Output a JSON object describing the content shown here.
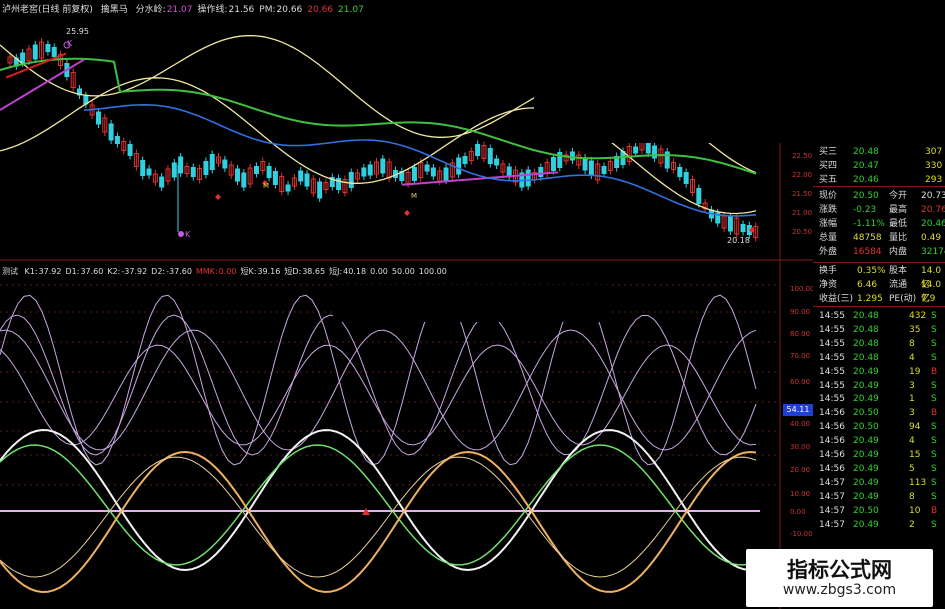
{
  "header": {
    "title": "泸州老窖(日线 前复权)",
    "indicator_name": "擒黑马",
    "fields": [
      {
        "label": "分水岭:",
        "value": "21.07",
        "color": "#d94cd9"
      },
      {
        "label": "操作线:",
        "value": "21.56",
        "color": "#dddddd"
      },
      {
        "label": "PM:",
        "value": "20.66",
        "color": "#dddddd"
      },
      {
        "label": "",
        "value": "20.66",
        "color": "#e03030"
      },
      {
        "label": "",
        "value": "21.07",
        "color": "#30d030"
      }
    ]
  },
  "price_labels": {
    "high": "25.95",
    "low": "20.18",
    "marks": [
      "K",
      "K",
      "M",
      "M"
    ]
  },
  "price_axis": [
    "22.50",
    "22.00",
    "21.50",
    "21.00",
    "20.50"
  ],
  "indicator_header": {
    "name": "测试",
    "fields": [
      {
        "label": "K1:",
        "value": "37.92",
        "color": "#dddddd"
      },
      {
        "label": "D1:",
        "value": "37.60",
        "color": "#dddddd"
      },
      {
        "label": "K2:",
        "value": "-37.92",
        "color": "#dddddd"
      },
      {
        "label": "D2:",
        "value": "-37.60",
        "color": "#dddddd"
      },
      {
        "label": "MMK:",
        "value": "0.00",
        "color": "#e03030"
      },
      {
        "label": "短K:",
        "value": "39.16",
        "color": "#dddddd"
      },
      {
        "label": "短D:",
        "value": "38.65",
        "color": "#dddddd"
      },
      {
        "label": "短J:",
        "value": "40.18",
        "color": "#dddddd"
      },
      {
        "label": "",
        "value": "0.00",
        "color": "#dddddd"
      },
      {
        "label": "",
        "value": "50.00",
        "color": "#dddddd"
      },
      {
        "label": "",
        "value": "100.00",
        "color": "#dddddd"
      }
    ]
  },
  "indicator_axis": [
    "100.00",
    "90.00",
    "80.00",
    "70.00",
    "60.00",
    "40.00",
    "30.00",
    "20.00",
    "10.00",
    "0.00",
    "-10.00",
    "-20.00"
  ],
  "indicator_badge": "54.11",
  "quotes": {
    "asks": [
      {
        "label": "买三",
        "price": "20.48",
        "vol": "307"
      },
      {
        "label": "买四",
        "price": "20.47",
        "vol": "330"
      },
      {
        "label": "买五",
        "price": "20.46",
        "vol": "293"
      }
    ],
    "stats": [
      {
        "l1": "现价",
        "v1": "20.50",
        "l2": "今开",
        "v2": "20.73",
        "c1": "#30d030",
        "c2": "#dddddd"
      },
      {
        "l1": "涨跌",
        "v1": "-0.23",
        "l2": "最高",
        "v2": "20.76",
        "c1": "#30d030",
        "c2": "#e03030"
      },
      {
        "l1": "涨幅",
        "v1": "-1.11%",
        "l2": "最低",
        "v2": "20.46",
        "c1": "#30d030",
        "c2": "#30d030"
      },
      {
        "l1": "总量",
        "v1": "48758",
        "l2": "量比",
        "v2": "0.49",
        "c1": "#dddd30",
        "c2": "#dddd30"
      },
      {
        "l1": "外盘",
        "v1": "16584",
        "l2": "内盘",
        "v2": "32174",
        "c1": "#e03030",
        "c2": "#30d030"
      }
    ],
    "stats2": [
      {
        "l1": "换手",
        "v1": "0.35%",
        "l2": "股本",
        "v2": "14.0亿"
      },
      {
        "l1": "净资",
        "v1": "6.46",
        "l2": "流通",
        "v2": "14.0亿"
      },
      {
        "l1": "收益(三)",
        "v1": "1.295",
        "l2": "PE(动)",
        "v2": "7.9"
      }
    ],
    "ticks": [
      {
        "time": "14:55",
        "price": "20.48",
        "vol": "432",
        "side": "S"
      },
      {
        "time": "14:55",
        "price": "20.48",
        "vol": "35",
        "side": "S"
      },
      {
        "time": "14:55",
        "price": "20.48",
        "vol": "8",
        "side": "S"
      },
      {
        "time": "14:55",
        "price": "20.48",
        "vol": "4",
        "side": "S"
      },
      {
        "time": "14:55",
        "price": "20.49",
        "vol": "19",
        "side": "B"
      },
      {
        "time": "14:55",
        "price": "20.49",
        "vol": "3",
        "side": "S"
      },
      {
        "time": "14:55",
        "price": "20.49",
        "vol": "1",
        "side": "S"
      },
      {
        "time": "14:56",
        "price": "20.50",
        "vol": "3",
        "side": "B"
      },
      {
        "time": "14:56",
        "price": "20.50",
        "vol": "94",
        "side": "S"
      },
      {
        "time": "14:56",
        "price": "20.49",
        "vol": "4",
        "side": "S"
      },
      {
        "time": "14:56",
        "price": "20.49",
        "vol": "15",
        "side": "S"
      },
      {
        "time": "14:56",
        "price": "20.49",
        "vol": "5",
        "side": "S"
      },
      {
        "time": "14:57",
        "price": "20.49",
        "vol": "113",
        "side": "S"
      },
      {
        "time": "14:57",
        "price": "20.49",
        "vol": "8",
        "side": "S"
      },
      {
        "time": "14:57",
        "price": "20.50",
        "vol": "10",
        "side": "B"
      },
      {
        "time": "14:57",
        "price": "20.49",
        "vol": "2",
        "side": "S"
      }
    ]
  },
  "watermark": {
    "title": "指标公式网",
    "url": "www.zbgs3.com"
  },
  "colors": {
    "up": "#e03030",
    "down": "#30d0e0",
    "ma_red": "#d82020",
    "ma_magenta": "#c040d0",
    "ma_green": "#40c040",
    "ma_blue": "#3070e0",
    "envelope": "#f0e8a0",
    "kd_white": "#f4f4f4",
    "kd_orange": "#f0b060",
    "kd_green": "#70e070",
    "kd_lilac": "#c8a8e0",
    "zero_line": "#e8b0f0"
  }
}
